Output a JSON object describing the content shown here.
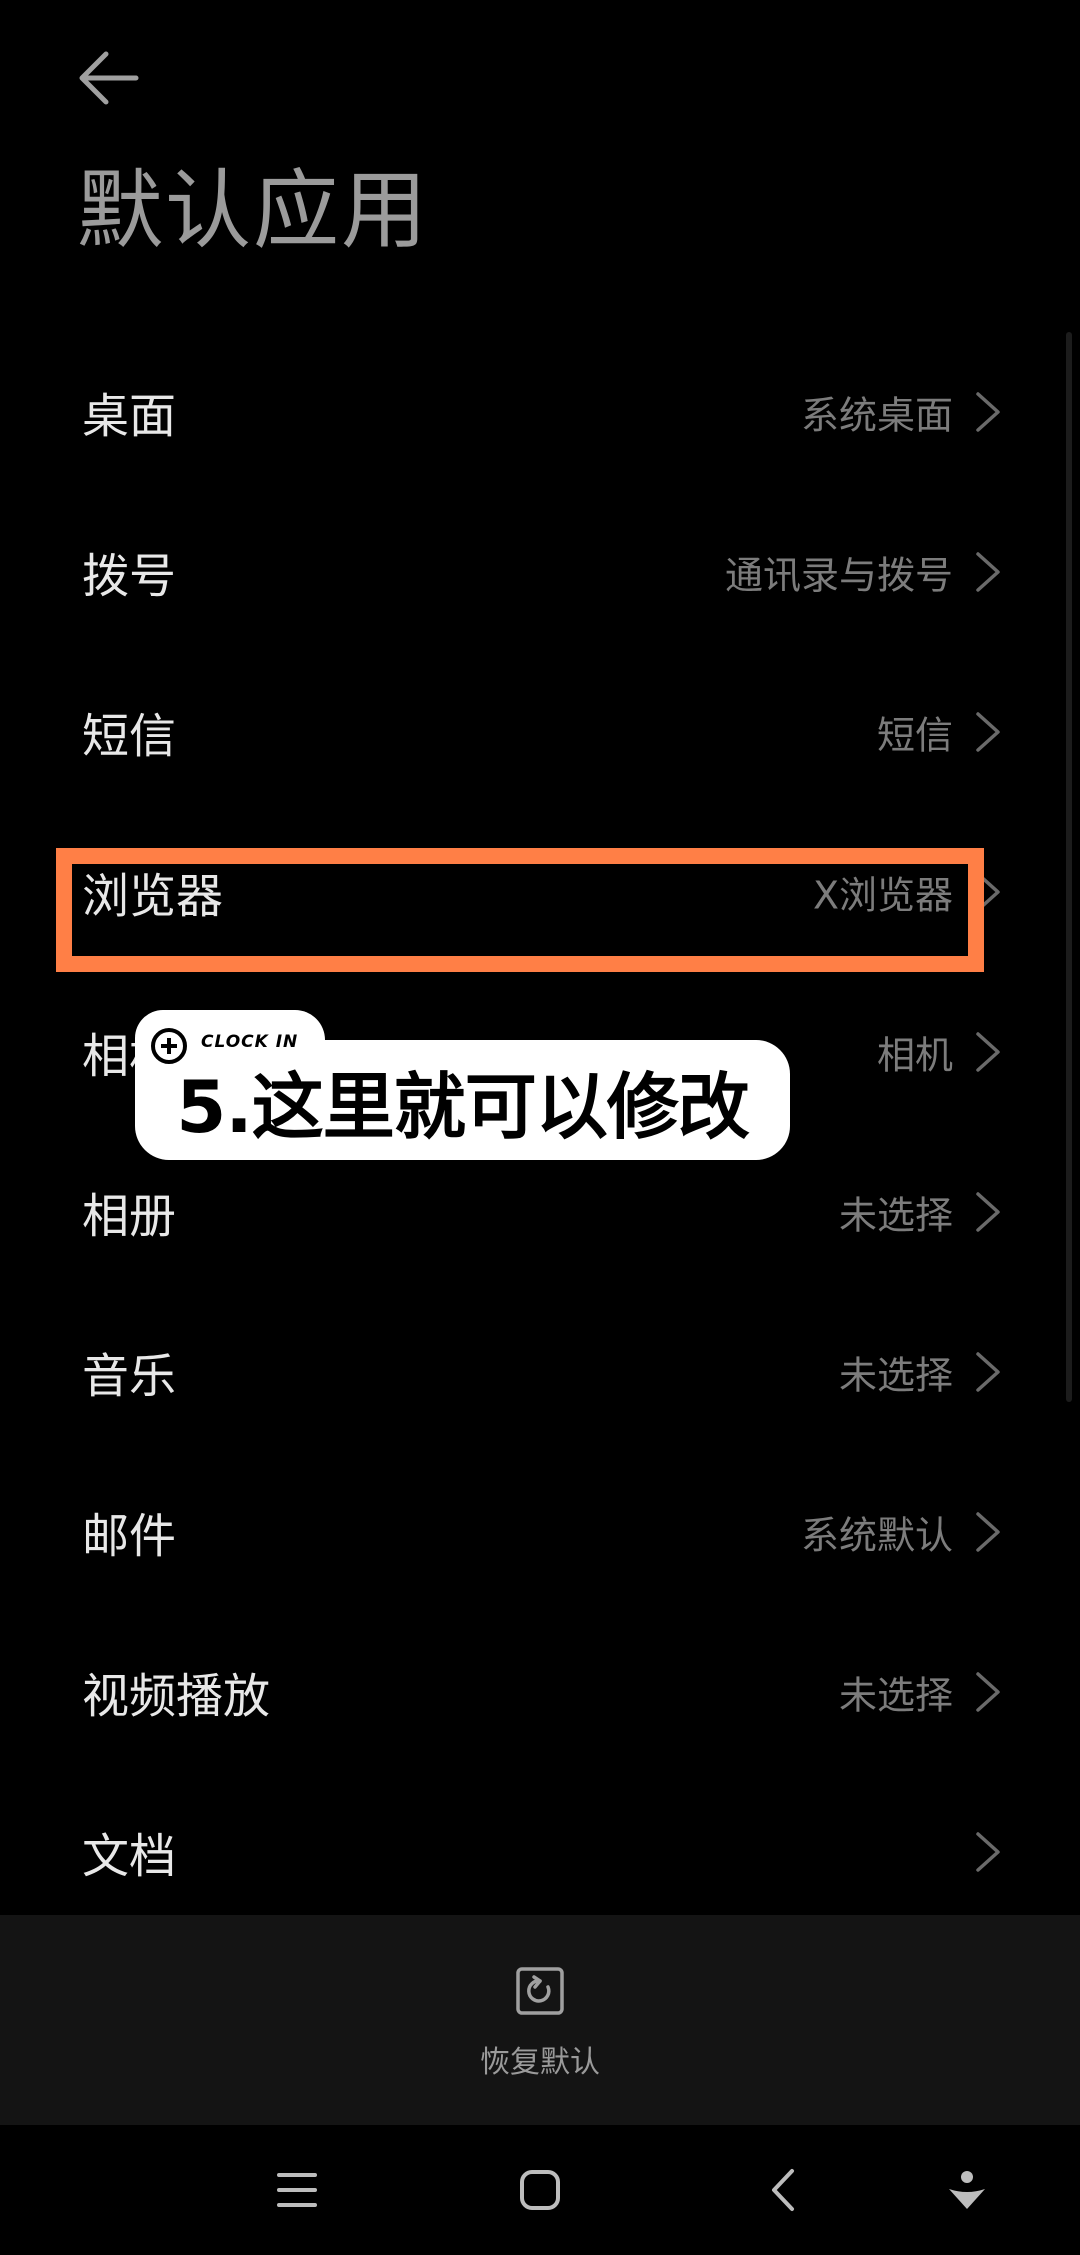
{
  "header": {
    "title": "默认应用"
  },
  "rows": [
    {
      "label": "桌面",
      "value": "系统桌面"
    },
    {
      "label": "拨号",
      "value": "通讯录与拨号"
    },
    {
      "label": "短信",
      "value": "短信"
    },
    {
      "label": "浏览器",
      "value": "X浏览器"
    },
    {
      "label": "相机",
      "value": "相机"
    },
    {
      "label": "相册",
      "value": "未选择"
    },
    {
      "label": "音乐",
      "value": "未选择"
    },
    {
      "label": "邮件",
      "value": "系统默认"
    },
    {
      "label": "视频播放",
      "value": "未选择"
    },
    {
      "label": "文档",
      "value": ""
    }
  ],
  "overlay": {
    "tag": "CLOCK IN",
    "caption": "5.这里就可以修改",
    "highlight_color": "#ff7f46"
  },
  "restore": {
    "label": "恢复默认"
  },
  "icons": {
    "back": "arrow-left-icon",
    "chevron": "chevron-right-icon",
    "restore": "restore-icon",
    "nav_menu": "menu-icon",
    "nav_home": "home-icon",
    "nav_back": "back-icon",
    "nav_extra": "assistant-icon"
  }
}
